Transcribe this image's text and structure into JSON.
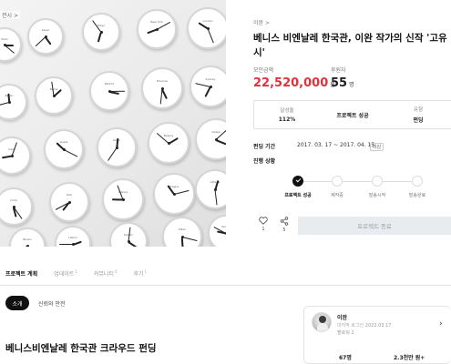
{
  "hero": {
    "crumb_fragment": "전시 >",
    "clock_labels": [
      "Paris",
      "Seoul",
      "Tokyo",
      "New York",
      "London",
      "Berlin",
      "Rome",
      "Madrid",
      "Moscow",
      "Sydney",
      "Cairo",
      "Dubai",
      "Delhi",
      "Beijing",
      "Osaka",
      "Lima",
      "Oslo",
      "Vienna",
      "Prague",
      "Athens",
      "Lisbon",
      "Dublin",
      "Milan",
      "Busan",
      "Venice",
      "Helsinki"
    ]
  },
  "breadcrumb": "이완 >",
  "title": "베니스 비엔날레 한국관, 이완 작가의 신작 '고유시'",
  "funding": {
    "amount_label": "모인금액",
    "amount": "22,520,000",
    "amount_unit": "원",
    "backers_label": "후원자",
    "backers": "55",
    "backers_unit": "명"
  },
  "stats": [
    {
      "key": "달성율",
      "value": "112%"
    },
    {
      "key": "",
      "value": "프로젝트 성공"
    },
    {
      "key": "유형",
      "value": "펀딩"
    }
  ],
  "period": {
    "label": "펀딩 기간",
    "value": "2017. 03. 17 ~ 2017. 04. 15",
    "tag": "마감"
  },
  "progress": {
    "label": "진행 상황",
    "steps": [
      {
        "label": "프로젝트 성공",
        "done": true
      },
      {
        "label": "제작중",
        "done": false
      },
      {
        "label": "발송시작",
        "done": false
      },
      {
        "label": "발송완료",
        "done": false
      }
    ]
  },
  "actions": {
    "like_count": "1",
    "share_count": "5",
    "end_button": "프로젝트 종료"
  },
  "tabs": [
    {
      "label": "프로젝트 계획",
      "count": ""
    },
    {
      "label": "업데이트",
      "count": "1"
    },
    {
      "label": "커뮤니티",
      "count": "6"
    },
    {
      "label": "후기",
      "count": "1"
    }
  ],
  "subtabs": {
    "active": "소개",
    "other": "신뢰와 안전"
  },
  "body_title": "베니스비엔날레 한국관 크라우드 펀딩",
  "creator": {
    "name": "이완",
    "last_login_label": "마지막 로그인",
    "last_login": "2022.03.17",
    "followers": "팔로워 2",
    "stat1": "67명",
    "stat2": "2.3천만 원+"
  },
  "colors": {
    "accent": "#e0323b"
  }
}
